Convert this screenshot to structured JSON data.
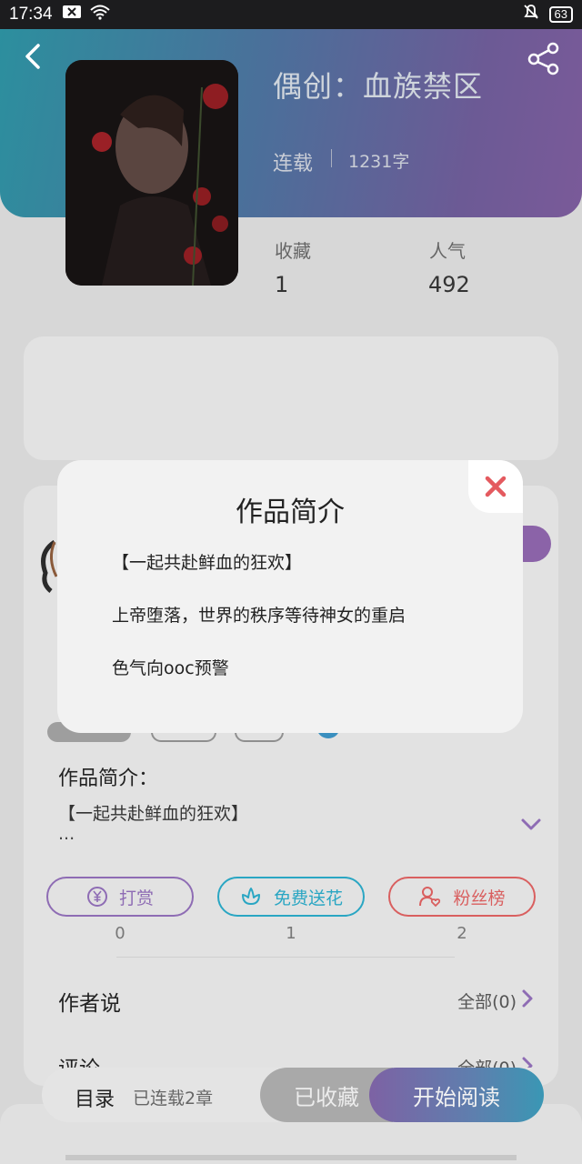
{
  "status_bar": {
    "time": "17:34",
    "battery": "63"
  },
  "book": {
    "title": "偶创：血族禁区",
    "status": "连载",
    "word_count": "1231字"
  },
  "stats": {
    "favorites_label": "收藏",
    "favorites_value": "1",
    "popularity_label": "人气",
    "popularity_value": "492"
  },
  "intro": {
    "label": "作品简介：",
    "preview": "【一起共赴鲜血的狂欢】",
    "ellipsis": "..."
  },
  "actions": [
    {
      "label": "打赏",
      "count": "0",
      "icon": "yuan-coin-icon",
      "color": "#8e6cb4"
    },
    {
      "label": "免费送花",
      "count": "1",
      "icon": "flower-icon",
      "color": "#2aa6c3"
    },
    {
      "label": "粉丝榜",
      "count": "2",
      "icon": "fan-user-heart-icon",
      "color": "#d95f5f"
    }
  ],
  "rows": {
    "author_says": "作者说",
    "author_says_link": "全部(0)",
    "comments": "评论",
    "comments_link": "全部(0)"
  },
  "bottom_bar": {
    "toc": "目录",
    "chapters": "已连载2章",
    "collected": "已收藏",
    "start_reading": "开始阅读"
  },
  "modal": {
    "title": "作品简介",
    "lines": [
      "【一起共赴鲜血的狂欢】",
      "上帝堕落，世界的秩序等待神女的重启",
      "色气向ooc预警"
    ],
    "close_color": "#e45a5f"
  }
}
